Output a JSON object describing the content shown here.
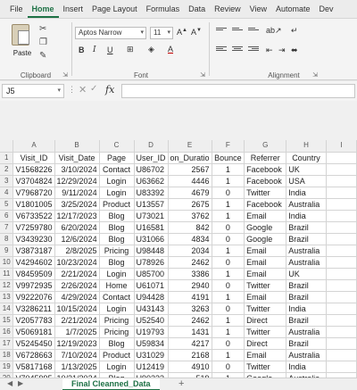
{
  "ribbon_tabs": [
    "File",
    "Home",
    "Insert",
    "Page Layout",
    "Formulas",
    "Data",
    "Review",
    "View",
    "Automate",
    "Dev"
  ],
  "active_tab": "Home",
  "clipboard": {
    "paste_label": "Paste",
    "group_label": "Clipboard"
  },
  "font": {
    "name": "Aptos Narrow",
    "size": "11",
    "group_label": "Font"
  },
  "alignment": {
    "group_label": "Alignment"
  },
  "formula_bar": {
    "cell_ref": "J5",
    "fx_label": "fx",
    "content": ""
  },
  "columns": [
    "A",
    "B",
    "C",
    "D",
    "E",
    "F",
    "G",
    "H",
    "I"
  ],
  "headers": [
    "Visit_ID",
    "Visit_Date",
    "Page",
    "User_ID",
    "on_Duratio",
    "Bounce",
    "Referrer",
    "Country",
    ""
  ],
  "rows": [
    [
      "V1568226",
      "3/10/2024",
      "Contact",
      "U86702",
      "2567",
      "1",
      "Facebook",
      "UK"
    ],
    [
      "V3704824",
      "12/29/2024",
      "Login",
      "U63662",
      "4446",
      "1",
      "Facebook",
      "USA"
    ],
    [
      "V7968720",
      "9/11/2024",
      "Login",
      "U83392",
      "4679",
      "0",
      "Twitter",
      "India"
    ],
    [
      "V1801005",
      "3/25/2024",
      "Product",
      "U13557",
      "2675",
      "1",
      "Facebook",
      "Australia"
    ],
    [
      "V6733522",
      "12/17/2023",
      "Blog",
      "U73021",
      "3762",
      "1",
      "Email",
      "India"
    ],
    [
      "V7259780",
      "6/20/2024",
      "Blog",
      "U16581",
      "842",
      "0",
      "Google",
      "Brazil"
    ],
    [
      "V3439230",
      "12/6/2024",
      "Blog",
      "U31066",
      "4834",
      "0",
      "Google",
      "Brazil"
    ],
    [
      "V3873187",
      "2/8/2025",
      "Pricing",
      "U98448",
      "2034",
      "1",
      "Email",
      "Australia"
    ],
    [
      "V4294602",
      "10/23/2024",
      "Blog",
      "U78926",
      "2462",
      "0",
      "Email",
      "Australia"
    ],
    [
      "V8459509",
      "2/21/2024",
      "Login",
      "U85700",
      "3386",
      "1",
      "Email",
      "UK"
    ],
    [
      "V9972935",
      "2/26/2024",
      "Home",
      "U61071",
      "2940",
      "0",
      "Twitter",
      "Brazil"
    ],
    [
      "V9222076",
      "4/29/2024",
      "Contact",
      "U94428",
      "4191",
      "1",
      "Email",
      "Brazil"
    ],
    [
      "V3286211",
      "10/15/2024",
      "Login",
      "U43143",
      "3263",
      "0",
      "Twitter",
      "India"
    ],
    [
      "V2057783",
      "2/21/2024",
      "Pricing",
      "U52540",
      "2462",
      "1",
      "Direct",
      "Brazil"
    ],
    [
      "V5069181",
      "1/7/2025",
      "Pricing",
      "U19793",
      "1431",
      "1",
      "Twitter",
      "Australia"
    ],
    [
      "V5245450",
      "12/19/2023",
      "Blog",
      "U59834",
      "4217",
      "0",
      "Direct",
      "Brazil"
    ],
    [
      "V6728663",
      "7/10/2024",
      "Product",
      "U31029",
      "2168",
      "1",
      "Email",
      "Australia"
    ],
    [
      "V5817168",
      "1/13/2025",
      "Login",
      "U12419",
      "4910",
      "0",
      "Twitter",
      "India"
    ],
    [
      "V7045995",
      "10/31/2024",
      "Blog",
      "U90233",
      "519",
      "1",
      "Google",
      "Australia"
    ]
  ],
  "sheet_tab": "Final Cleanned_Data",
  "add_sheet": "+"
}
